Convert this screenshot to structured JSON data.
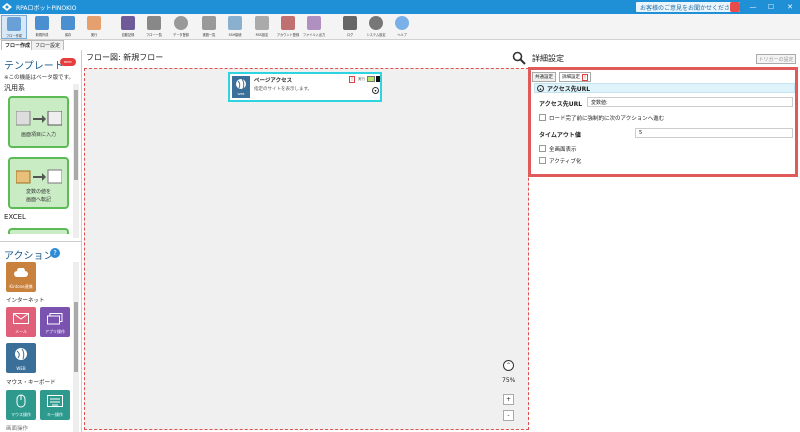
{
  "window": {
    "title": "RPAロボットPINOKIO",
    "feedback": "お客様のご意見をお聞かせください",
    "minimize": "—",
    "maximize": "☐",
    "close": "✕"
  },
  "toolbar": [
    {
      "label": "フロー作成",
      "color": "#6aa0d8"
    },
    {
      "label": "新規作成",
      "color": "#4a8fd0"
    },
    {
      "label": "保存",
      "color": "#4a8fd0"
    },
    {
      "label": "実行",
      "color": "#e6a070"
    },
    {
      "label": "自動記録",
      "color": "#6f5a9a"
    },
    {
      "label": "フロー一覧",
      "color": "#888888"
    },
    {
      "label": "データ登録",
      "color": "#999999"
    },
    {
      "label": "実施一覧",
      "color": "#999999"
    },
    {
      "label": "SSH接続",
      "color": "#8ab0d0"
    },
    {
      "label": "RSS設定",
      "color": "#aaaaaa"
    },
    {
      "label": "アカウント登録",
      "color": "#c07070"
    },
    {
      "label": "ファイル入出力",
      "color": "#b090c0"
    },
    {
      "label": "ログ",
      "color": "#666666"
    },
    {
      "label": "システム設定",
      "color": "#777777"
    },
    {
      "label": "ヘルプ",
      "color": "#7ab0e8"
    }
  ],
  "tabs": {
    "flow_create": "フロー作成",
    "flow_settings": "フロー設定"
  },
  "left": {
    "template_title": "テンプレート",
    "new_badge": "NEW!",
    "beta_note": "※この機能はベータ版です。",
    "general": "汎用系",
    "card1": "画面項目に入力",
    "card2_line1": "変数の値を",
    "card2_line2": "画面へ転記",
    "excel": "EXCEL",
    "action_title": "アクション",
    "help": "?",
    "kintone": "Kintone連携",
    "internet": "インターネット",
    "mail": "メール",
    "app_op": "アプリ操作",
    "web": "WEB",
    "mouse_kb": "マウス・キーボード",
    "mouse_op": "マウス操作",
    "key_op": "キー操作",
    "cut": "画面操作"
  },
  "flow": {
    "header": "フロー図:  新規フロー",
    "node_title": "ページアクセス",
    "node_desc": "指定のサイトを表示します。",
    "node_exec": "実行",
    "node_icon_label": "WEB",
    "zoom": "75%",
    "plus": "+",
    "minus": "-",
    "up": "⌃"
  },
  "right": {
    "title": "詳細設定",
    "trigger": "トリガーの設定",
    "tab_common": "共通設定",
    "tab_detail": "詳細設定",
    "warn": "!",
    "section": "アクセス先URL",
    "url_label": "アクセス先URL",
    "url_value": "変数値:",
    "force_label": "ロード完了前に強制的に次のアクションへ進む",
    "timeout_label": "タイムアウト値",
    "timeout_value": "5",
    "fullscreen": "全画面表示",
    "activate": "アクティブ化"
  }
}
